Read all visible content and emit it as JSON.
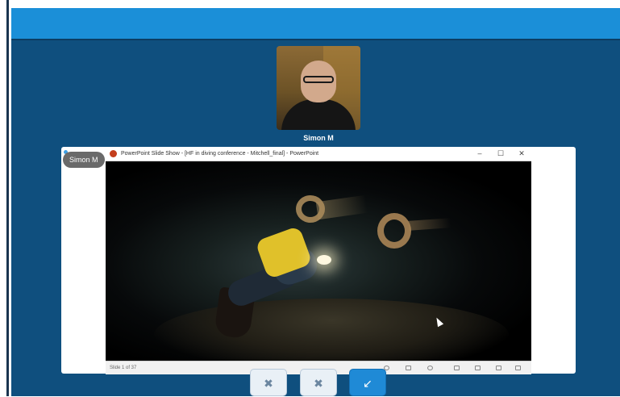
{
  "participant": {
    "name": "Simon M"
  },
  "share": {
    "presenter_chip": "Simon M"
  },
  "powerpoint": {
    "window_title": "PowerPoint Slide Show - [HF in diving conference - Mitchell_final] - PowerPoint",
    "minimize_glyph": "–",
    "maximize_glyph": "☐",
    "close_glyph": "✕",
    "slide_counter": "Slide 1 of 37"
  },
  "controls": {
    "mute_icon": "✖",
    "video_icon": "✖",
    "share_icon": "↙"
  },
  "colors": {
    "topbar": "#1b8fd8",
    "stage": "#0f4f7e",
    "accent_button": "#1f8ad6"
  }
}
